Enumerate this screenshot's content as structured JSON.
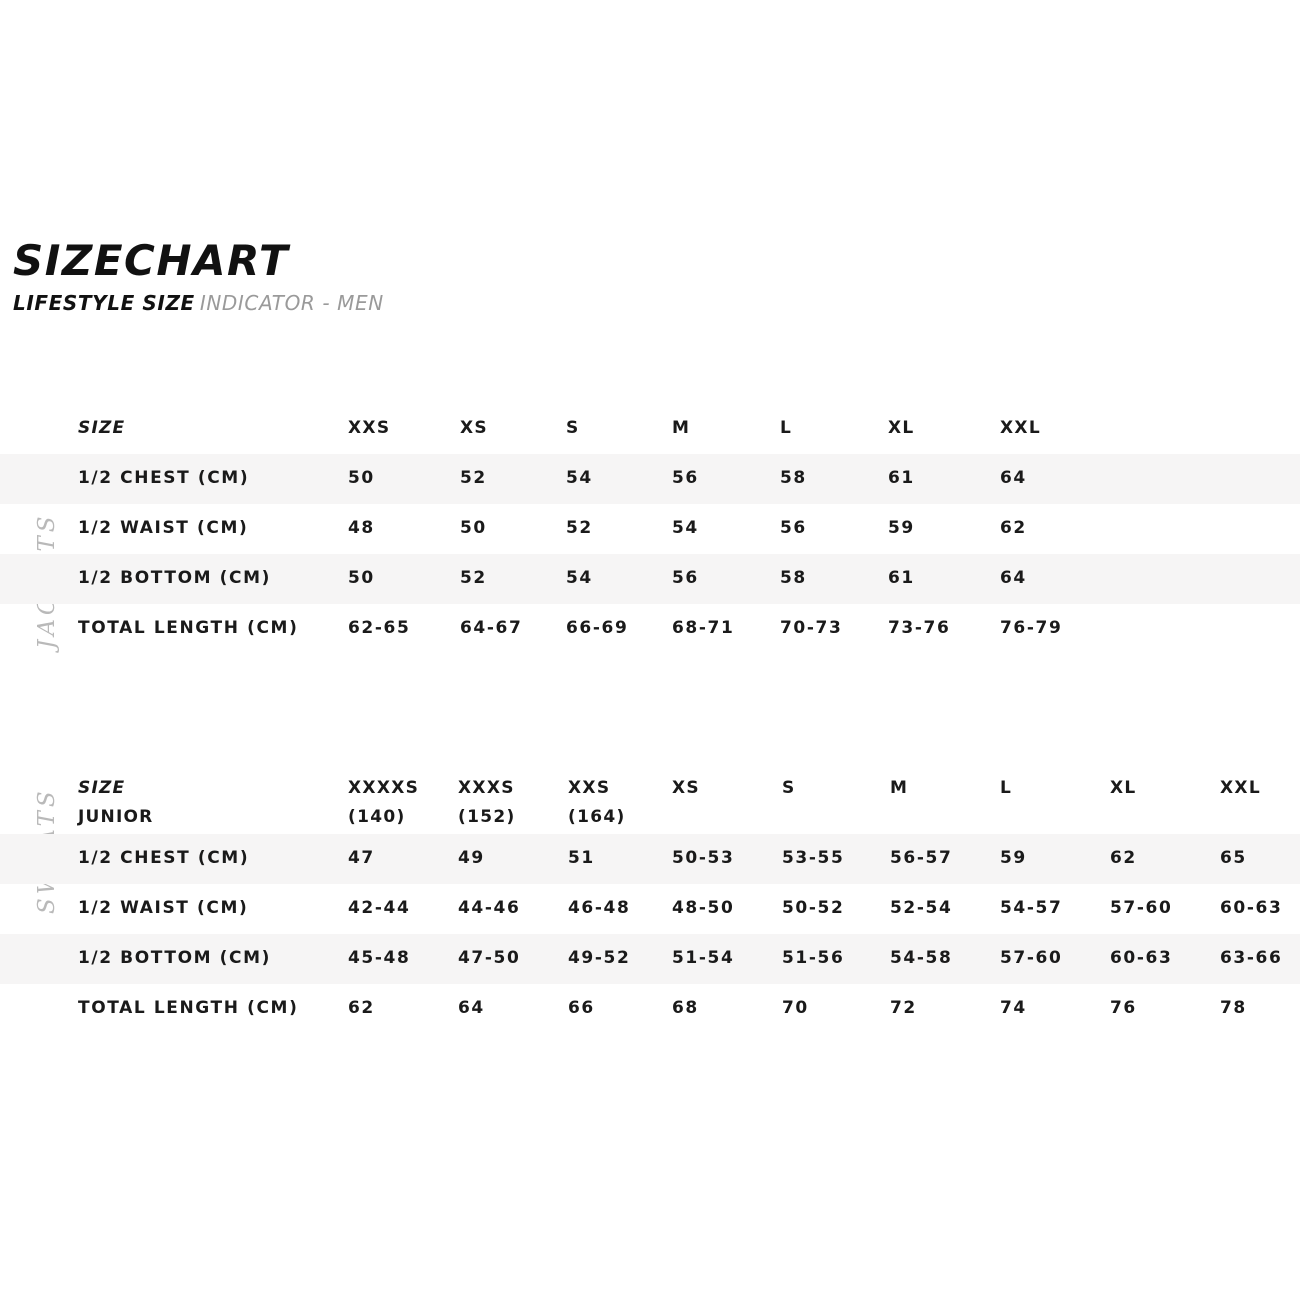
{
  "heading": {
    "title": "SIZECHART",
    "subtitle_strong": "LIFESTYLE SIZE",
    "subtitle_light": "INDICATOR - MEN"
  },
  "colors": {
    "background": "#ffffff",
    "text": "#1a1a1a",
    "row_shade": "#f6f5f5",
    "muted": "#9a9a9a",
    "side_label": "#b9b9b9"
  },
  "tables": [
    {
      "side_label": "JACKETS",
      "header": {
        "label": "SIZE",
        "sublabel": "",
        "sizes": [
          "XXS",
          "XS",
          "S",
          "M",
          "L",
          "XL",
          "XXL"
        ],
        "subsizes": []
      },
      "rows": [
        {
          "label": "1/2 CHEST (CM)",
          "shaded": true,
          "values": [
            "50",
            "52",
            "54",
            "56",
            "58",
            "61",
            "64"
          ]
        },
        {
          "label": "1/2 WAIST (CM)",
          "shaded": false,
          "values": [
            "48",
            "50",
            "52",
            "54",
            "56",
            "59",
            "62"
          ]
        },
        {
          "label": "1/2 BOTTOM (CM)",
          "shaded": true,
          "values": [
            "50",
            "52",
            "54",
            "56",
            "58",
            "61",
            "64"
          ]
        },
        {
          "label": "TOTAL LENGTH (CM)",
          "shaded": false,
          "values": [
            "62-65",
            "64-67",
            "66-69",
            "68-71",
            "70-73",
            "73-76",
            "76-79"
          ]
        }
      ]
    },
    {
      "side_label": "SWEATS",
      "header": {
        "label": "SIZE",
        "sublabel": "JUNIOR",
        "sizes": [
          "XXXXS",
          "XXXS",
          "XXS",
          "XS",
          "S",
          "M",
          "L",
          "XL",
          "XXL"
        ],
        "subsizes": [
          "(140)",
          "(152)",
          "(164)",
          "",
          "",
          "",
          "",
          "",
          ""
        ]
      },
      "rows": [
        {
          "label": "1/2 CHEST (CM)",
          "shaded": true,
          "values": [
            "47",
            "49",
            "51",
            "50-53",
            "53-55",
            "56-57",
            "59",
            "62",
            "65"
          ]
        },
        {
          "label": "1/2 WAIST (CM)",
          "shaded": false,
          "values": [
            "42-44",
            "44-46",
            "46-48",
            "48-50",
            "50-52",
            "52-54",
            "54-57",
            "57-60",
            "60-63"
          ]
        },
        {
          "label": "1/2 BOTTOM (CM)",
          "shaded": true,
          "values": [
            "45-48",
            "47-50",
            "49-52",
            "51-54",
            "51-56",
            "54-58",
            "57-60",
            "60-63",
            "63-66"
          ]
        },
        {
          "label": "TOTAL LENGTH (CM)",
          "shaded": false,
          "values": [
            "62",
            "64",
            "66",
            "68",
            "70",
            "72",
            "74",
            "76",
            "78"
          ]
        }
      ]
    }
  ],
  "layout": {
    "column_x_table1": [
      348,
      460,
      566,
      672,
      780,
      888,
      1000
    ],
    "column_x_table2": [
      348,
      458,
      568,
      672,
      782,
      890,
      1000,
      1110,
      1220
    ]
  }
}
